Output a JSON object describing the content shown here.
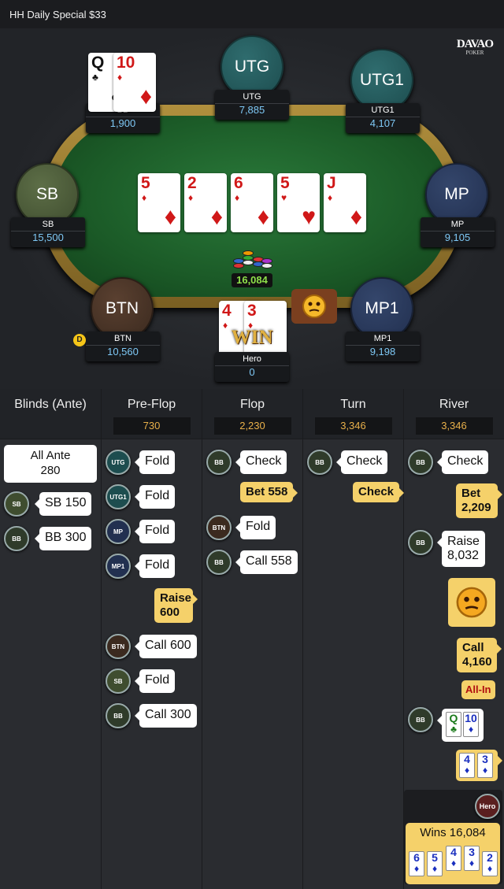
{
  "header": {
    "title": "HH  Daily Special $33"
  },
  "logo": {
    "text1": "DAVAO",
    "text2": "POKER"
  },
  "seats": [
    {
      "pos": "UTG",
      "name": "UTG",
      "stack": "7,885",
      "color": "teal"
    },
    {
      "pos": "UTG1",
      "name": "UTG1",
      "stack": "4,107",
      "color": "teal"
    },
    {
      "pos": "MP",
      "name": "MP",
      "stack": "9,105",
      "color": "navy"
    },
    {
      "pos": "MP1",
      "name": "MP1",
      "stack": "9,198",
      "color": "navy"
    },
    {
      "pos": "BTN",
      "name": "BTN",
      "stack": "10,560",
      "color": "brown"
    },
    {
      "pos": "SB",
      "name": "SB",
      "stack": "15,500",
      "color": "olive"
    },
    {
      "pos": "BB",
      "name": "BB",
      "stack": "1,900"
    },
    {
      "pos": "Hero",
      "name": "Hero",
      "stack": "0"
    }
  ],
  "board": [
    {
      "rank": "5",
      "suit": "♦"
    },
    {
      "rank": "2",
      "suit": "♦"
    },
    {
      "rank": "6",
      "suit": "♦"
    },
    {
      "rank": "5",
      "suit": "♥"
    },
    {
      "rank": "J",
      "suit": "♦"
    }
  ],
  "bb_cards": [
    {
      "rank": "Q",
      "suit": "♣"
    },
    {
      "rank": "10",
      "suit": "♦"
    }
  ],
  "hero_cards": [
    {
      "rank": "4",
      "suit": "♦"
    },
    {
      "rank": "3",
      "suit": "♦"
    }
  ],
  "pot": "16,084",
  "dealer": "D",
  "win_text": "WIN",
  "columns": [
    {
      "title": "Blinds (Ante)",
      "value": ""
    },
    {
      "title": "Pre-Flop",
      "value": "730"
    },
    {
      "title": "Flop",
      "value": "2,230"
    },
    {
      "title": "Turn",
      "value": "3,346"
    },
    {
      "title": "River",
      "value": "3,346"
    }
  ],
  "blinds": {
    "ante_label": "All Ante",
    "ante_value": "280",
    "sb_av": "SB",
    "sb": "SB 150",
    "bb_av": "BB",
    "bb": "BB 300"
  },
  "preflop": [
    {
      "av": "UTG",
      "act": "Fold"
    },
    {
      "av": "UTG1",
      "act": "Fold"
    },
    {
      "av": "MP",
      "act": "Fold"
    },
    {
      "av": "MP1",
      "act": "Fold"
    },
    {
      "hero1": "Raise",
      "hero2": "600"
    },
    {
      "av": "BTN",
      "act": "Call 600"
    },
    {
      "av": "SB",
      "act": "Fold"
    },
    {
      "av": "BB",
      "act": "Call 300"
    }
  ],
  "flop": {
    "a1": "BB",
    "c1": "Check",
    "hero": "Bet 558",
    "a2": "BTN",
    "c2": "Fold",
    "a3": "BB",
    "c3": "Call 558"
  },
  "turn": {
    "a1": "BB",
    "c1": "Check",
    "hero": "Check"
  },
  "river": {
    "a1": "BB",
    "c1": "Check",
    "bet1": "Bet",
    "bet2": "2,209",
    "a2": "BB",
    "r1": "Raise",
    "r2": "8,032",
    "call1": "Call",
    "call2": "4,160",
    "allin": "All-In",
    "a3": "BB",
    "hero_av": "Hero",
    "wins": "Wins 16,084"
  },
  "showdown_bb": [
    {
      "rank": "Q",
      "suit": "♣"
    },
    {
      "rank": "10",
      "suit": "♦"
    }
  ],
  "showdown_hero": [
    {
      "rank": "4",
      "suit": "♦"
    },
    {
      "rank": "3",
      "suit": "♦"
    }
  ],
  "wins_cards": [
    {
      "rank": "6",
      "suit": "♦"
    },
    {
      "rank": "5",
      "suit": "♦"
    },
    {
      "rank": "4",
      "suit": "♦"
    },
    {
      "rank": "3",
      "suit": "♦"
    },
    {
      "rank": "2",
      "suit": "♦"
    }
  ]
}
